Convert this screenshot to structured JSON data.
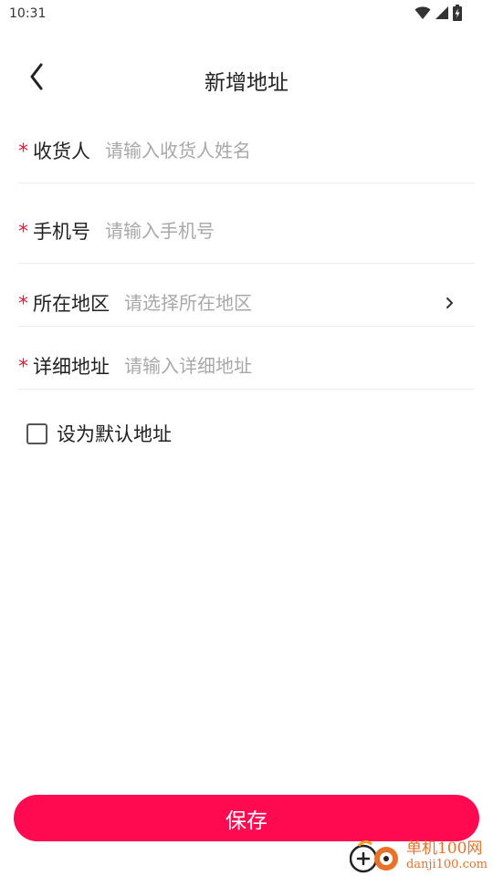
{
  "status_bar": {
    "time": "10:31",
    "icons": [
      "wifi-icon",
      "cellular-signal-icon",
      "battery-charging-icon"
    ]
  },
  "header": {
    "title": "新增地址",
    "back_icon": "chevron-left-icon"
  },
  "form": {
    "fields": [
      {
        "required_mark": "*",
        "label": "收货人",
        "placeholder": "请输入收货人姓名",
        "value": ""
      },
      {
        "required_mark": "*",
        "label": "手机号",
        "placeholder": "请输入手机号",
        "value": ""
      },
      {
        "required_mark": "*",
        "label": "所在地区",
        "placeholder": "请选择所在地区",
        "value": "",
        "trailing_icon": "chevron-right-icon"
      },
      {
        "required_mark": "*",
        "label": "详细地址",
        "placeholder": "请输入详细地址",
        "value": ""
      }
    ],
    "default_checkbox": {
      "label": "设为默认地址",
      "checked": false
    }
  },
  "actions": {
    "save_label": "保存"
  },
  "watermark": {
    "cn_text": "单机100网",
    "url_text": "danji100.com"
  },
  "colors": {
    "accent": "#ff0a50",
    "required_star": "#e8183a",
    "placeholder": "#a8a8a8",
    "divider": "#ececec",
    "watermark": "#e9722a"
  }
}
